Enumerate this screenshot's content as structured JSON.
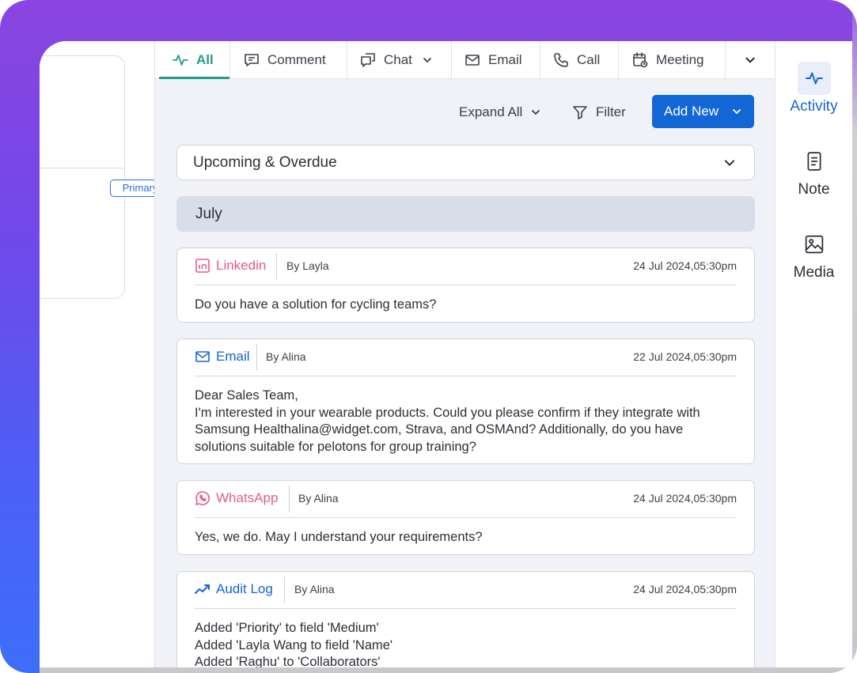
{
  "tabs": [
    {
      "label": "All",
      "icon": "activity-icon",
      "active": true
    },
    {
      "label": "Comment",
      "icon": "comment-icon"
    },
    {
      "label": "Chat",
      "icon": "chat-icon"
    },
    {
      "label": "Email",
      "icon": "email-icon"
    },
    {
      "label": "Call",
      "icon": "phone-icon"
    },
    {
      "label": "Meeting",
      "icon": "calendar-icon"
    }
  ],
  "left": {
    "badge": "Primary"
  },
  "toolbar": {
    "expand_label": "Expand All",
    "filter_label": "Filter",
    "add_new_label": "Add New"
  },
  "sections": {
    "upcoming": "Upcoming & Overdue",
    "month": "July"
  },
  "activities": [
    {
      "type": "Linkedin",
      "by": "By Layla",
      "time": "24 Jul 2024,05:30pm",
      "body": "Do you have a solution for cycling teams?",
      "color": "#e25b8e"
    },
    {
      "type": "Email",
      "by": "By Alina",
      "time": "22 Jul 2024,05:30pm",
      "body": "Dear Sales Team,\nI'm interested in your wearable products. Could you please confirm if they integrate with Samsung Healthalina@widget.com, Strava, and OSMAnd? Additionally, do you have solutions suitable for pelotons for group training?",
      "color": "#1366d6"
    },
    {
      "type": "WhatsApp",
      "by": "By Alina",
      "time": "24 Jul 2024,05:30pm",
      "body": "Yes, we do. May I understand your requirements?",
      "color": "#e25b8e"
    },
    {
      "type": "Audit Log",
      "by": "By Alina",
      "time": "24 Jul 2024,05:30pm",
      "body": "Added 'Priority' to field 'Medium'\nAdded 'Layla Wang to field 'Name'\nAdded 'Raghu' to 'Collaborators'",
      "color": "#1366d6"
    }
  ],
  "rail": [
    {
      "label": "Activity",
      "icon": "activity-icon",
      "active": true
    },
    {
      "label": "Note",
      "icon": "note-icon"
    },
    {
      "label": "Media",
      "icon": "image-icon"
    }
  ],
  "colors": {
    "accent": "#1366d6",
    "tab_active": "#1f9d8c",
    "pink": "#e25b8e"
  }
}
